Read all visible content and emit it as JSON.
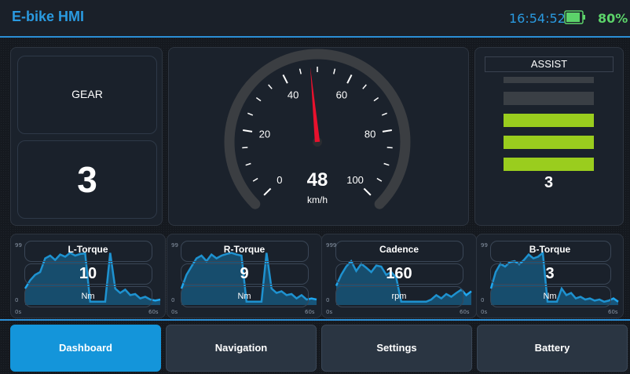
{
  "header": {
    "title": "E-bike HMI",
    "time": "16:54:52",
    "battery_percent": "80%"
  },
  "gear": {
    "label": "GEAR",
    "value": "3"
  },
  "speedometer": {
    "value": "48",
    "unit": "km/h",
    "tick_labels": [
      "0",
      "20",
      "40",
      "60",
      "80",
      "100"
    ],
    "min": 0,
    "max": 100,
    "needle_value": 48
  },
  "assist": {
    "label": "ASSIST",
    "level": 3,
    "max_level": 5,
    "value": "3"
  },
  "sensors": [
    {
      "title": "L-Torque",
      "value": "10",
      "unit": "Nm",
      "y_max": "99",
      "y_min": "0",
      "x_start": "0s",
      "x_end": "60s"
    },
    {
      "title": "R-Torque",
      "value": "9",
      "unit": "Nm",
      "y_max": "99",
      "y_min": "0",
      "x_start": "0s",
      "x_end": "60s"
    },
    {
      "title": "Cadence",
      "value": "160",
      "unit": "rpm",
      "y_max": "999",
      "y_min": "0",
      "x_start": "0s",
      "x_end": "60s"
    },
    {
      "title": "B-Torque",
      "value": "3",
      "unit": "Nm",
      "y_max": "99",
      "y_min": "0",
      "x_start": "0s",
      "x_end": "60s"
    }
  ],
  "nav": [
    {
      "label": "Dashboard",
      "active": true
    },
    {
      "label": "Navigation",
      "active": false
    },
    {
      "label": "Settings",
      "active": false
    },
    {
      "label": "Battery",
      "active": false
    }
  ],
  "colors": {
    "accent": "#1495da",
    "assist_on": "#9acd1e",
    "assist_off": "#3a3f45",
    "needle": "#e8112d",
    "battery": "#5cd36a"
  }
}
